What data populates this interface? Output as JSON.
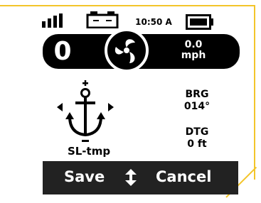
{
  "status": {
    "time": "10:50 A",
    "signal_icon": "signal-bars-icon",
    "battery_icon": "battery-charging-icon",
    "battery_full_icon": "battery-full-icon"
  },
  "speed": {
    "mode_value": "0",
    "reading_value": "0.0",
    "reading_unit": "mph",
    "icon": "propeller-icon"
  },
  "anchor": {
    "name": "SL-tmp",
    "icon": "anchor-icon"
  },
  "readouts": {
    "bearing_label": "BRG",
    "bearing_value": "014°",
    "distance_label": "DTG",
    "distance_value": "0 ft"
  },
  "softkeys": {
    "left_label": "Save",
    "right_label": "Cancel",
    "center_icon": "up-down-arrows-icon"
  },
  "colors": {
    "frame": "#f3c52a",
    "bar": "#000000",
    "softkey_bg": "#222222",
    "text": "#000000",
    "text_inverse": "#ffffff"
  }
}
